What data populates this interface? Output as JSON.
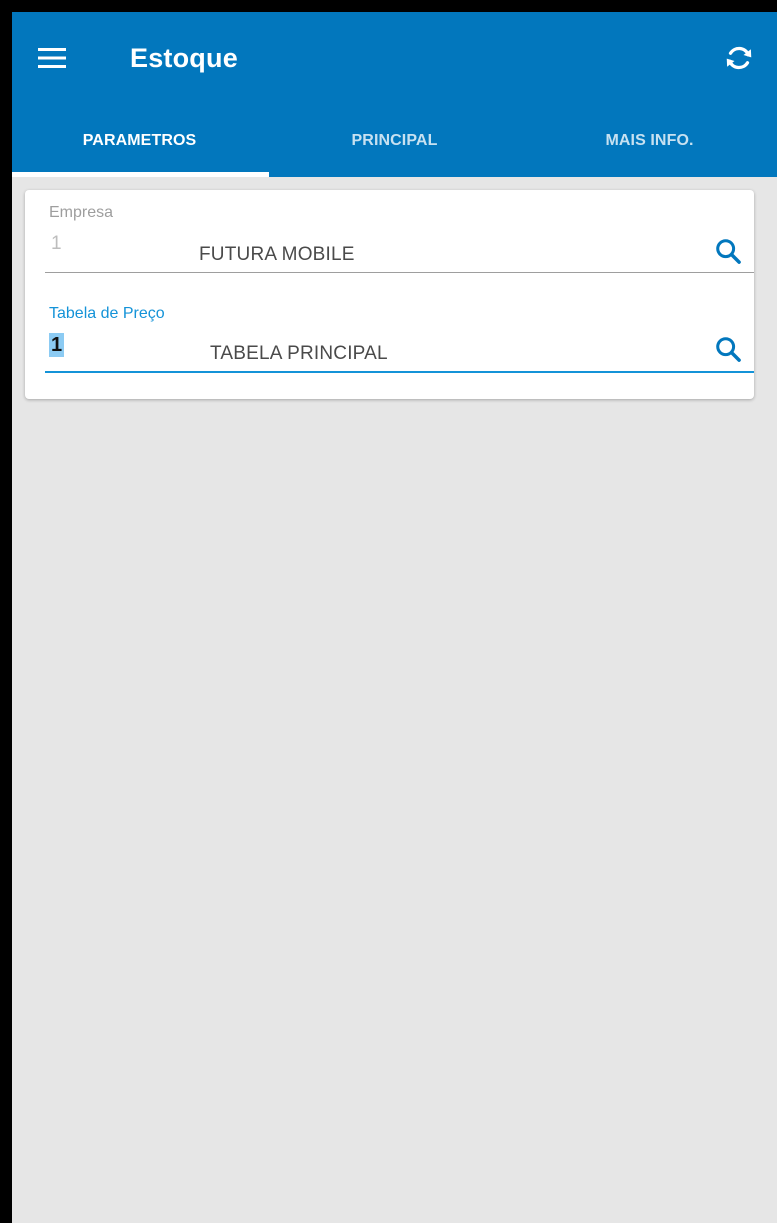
{
  "app": {
    "title": "Estoque"
  },
  "colors": {
    "primary": "#0277bd",
    "accent": "#1493d8",
    "background": "#e6e6e6"
  },
  "icons": {
    "menu": "hamburger-menu-icon",
    "sync": "sync-icon",
    "search": "search-icon"
  },
  "tabs": [
    {
      "label": "PARAMETROS",
      "active": true
    },
    {
      "label": "PRINCIPAL",
      "active": false
    },
    {
      "label": "MAIS INFO.",
      "active": false
    }
  ],
  "form": {
    "empresa": {
      "label": "Empresa",
      "code": "1",
      "description": "FUTURA MOBILE"
    },
    "tabela_preco": {
      "label": "Tabela de Preço",
      "code": "1",
      "description": "TABELA PRINCIPAL"
    }
  }
}
